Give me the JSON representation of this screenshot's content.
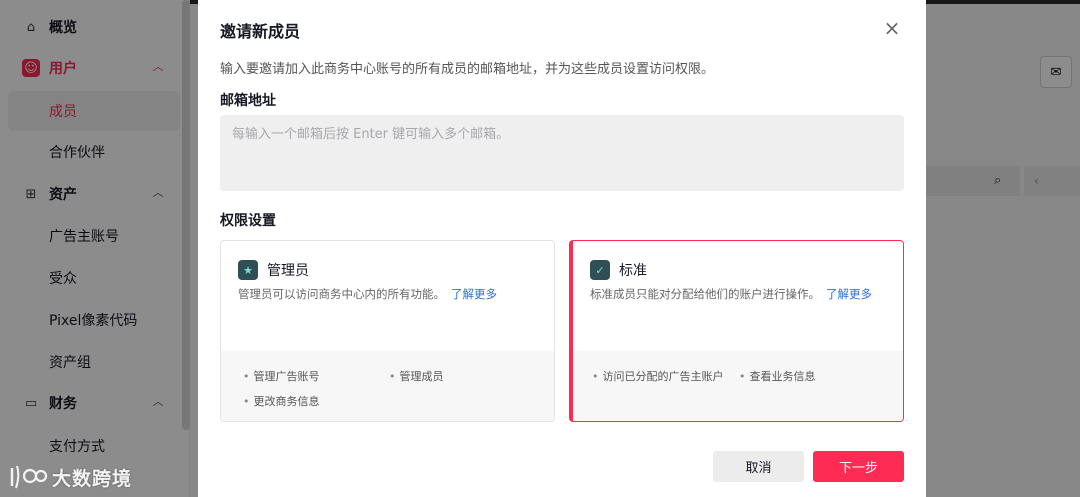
{
  "sidebar": {
    "overview": "概览",
    "users": {
      "label": "用户",
      "items": [
        "成员",
        "合作伙伴"
      ]
    },
    "assets": {
      "label": "资产",
      "items": [
        "广告主账号",
        "受众",
        "Pixel像素代码",
        "资产组"
      ]
    },
    "finance": {
      "label": "财务",
      "items": [
        "支付方式"
      ]
    },
    "active_item": "成员"
  },
  "modal": {
    "title": "邀请新成员",
    "description": "输入要邀请加入此商务中心账号的所有成员的邮箱地址，并为这些成员设置访问权限。",
    "email_label": "邮箱地址",
    "email_placeholder": "每输入一个邮箱后按 Enter 键可输入多个邮箱。",
    "permission_label": "权限设置",
    "roles": [
      {
        "name": "管理员",
        "description": "管理员可以访问商务中心内的所有功能。",
        "link": "了解更多",
        "permissions": [
          "管理广告账号",
          "管理成员",
          "更改商务信息"
        ],
        "selected": false
      },
      {
        "name": "标准",
        "description": "标准成员只能对分配给他们的账户进行操作。",
        "link": "了解更多",
        "permissions": [
          "访问已分配的广告主账户",
          "查看业务信息"
        ],
        "selected": true
      }
    ],
    "cancel_label": "取消",
    "next_label": "下一步"
  },
  "watermark": "大数跨境",
  "colors": {
    "accent": "#fe2c55",
    "link": "#2b6fdb"
  }
}
